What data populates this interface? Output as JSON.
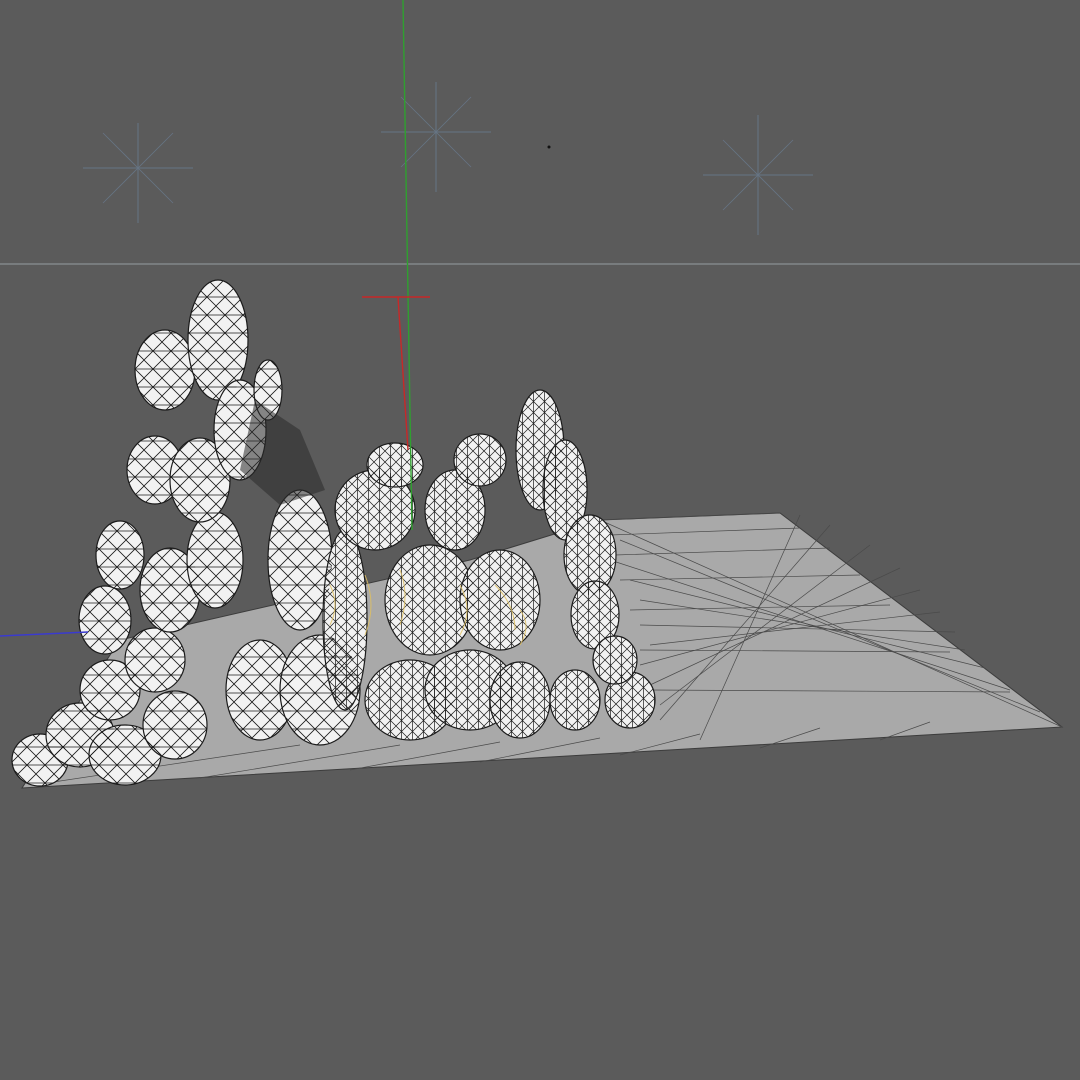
{
  "viewport": {
    "background": "#5b5b5b",
    "horizon_color": "#8a8f94",
    "axis_colors": {
      "x": "#c82828",
      "y": "#2fa02f",
      "z": "#3a3ad0"
    },
    "mesh_fill": "#f2f2f2",
    "mesh_wire": "#1b1b1b",
    "ground_fill": "#a9a9a9",
    "ground_wire": "#4a4a4a",
    "highlight_color": "#e0c060",
    "light_color": "#6f8aa6"
  },
  "icons": {
    "light_1": "light-gizmo-icon",
    "light_2": "light-gizmo-icon",
    "light_3": "light-gizmo-icon",
    "axis_gizmo": "axis-gizmo-icon"
  }
}
